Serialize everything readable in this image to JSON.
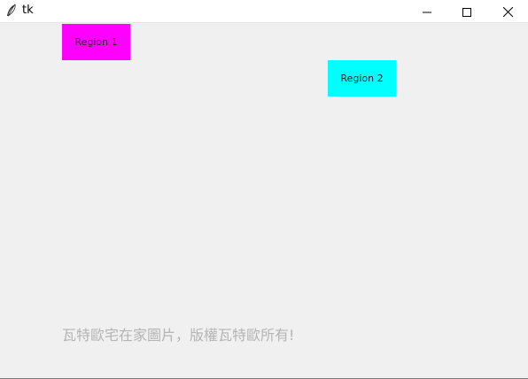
{
  "window": {
    "title": "tk",
    "app_icon": "feather-icon",
    "controls": {
      "minimize_icon": "minimize-icon",
      "maximize_icon": "maximize-icon",
      "close_icon": "close-icon"
    }
  },
  "regions": [
    {
      "label": "Region 1",
      "color": "#ff00ff"
    },
    {
      "label": "Region 2",
      "color": "#00ffff"
    }
  ],
  "watermark": {
    "text": "瓦特歐宅在家圖片，版權瓦特歐所有!"
  }
}
